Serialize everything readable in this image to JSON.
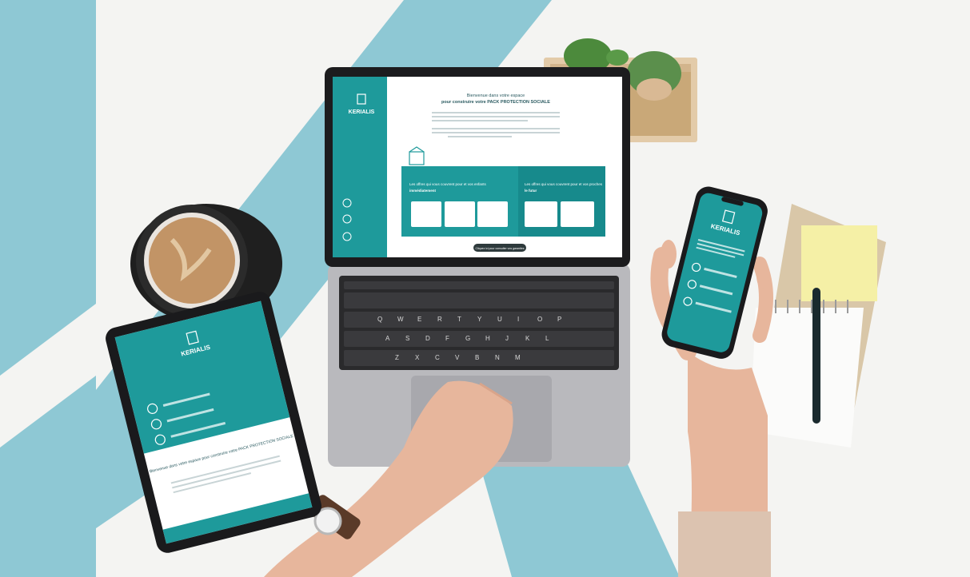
{
  "colors": {
    "teal_stripe": "#8ec8d4",
    "brand_teal": "#1e9a9b",
    "brand_teal_dark": "#157f82",
    "desk": "#f4f4f2",
    "laptop_body": "#b9b9bd",
    "keyboard": "#2a2a2c",
    "coffee": "#c29466",
    "sticky_note": "#f5f0a6",
    "notebook_cover": "#d9c7a8"
  },
  "brand": {
    "logo_text": "KERIALIS"
  },
  "laptop_screen": {
    "heading_line1": "Bienvenue dans votre espace",
    "heading_line2": "pour construire votre PACK PROTECTION SOCIALE",
    "panel_left_title": "Les offres qui vous couvrent pour et vos enfants",
    "panel_left_subtitle": "immédiatement",
    "panel_right_title": "Les offres qui vous couvrent pour et vos proches",
    "panel_right_subtitle": "le futur",
    "cta_button": "Cliquez ici pour consulter vos garanties"
  },
  "keyboard": {
    "row1": [
      "Q",
      "W",
      "E",
      "R",
      "T",
      "Y",
      "U",
      "I",
      "O",
      "P"
    ],
    "row2": [
      "A",
      "S",
      "D",
      "F",
      "G",
      "H",
      "J",
      "K",
      "L"
    ],
    "row3": [
      "Z",
      "X",
      "C",
      "V",
      "B",
      "N",
      "M"
    ]
  },
  "tablet_screen": {
    "logo_text": "KERIALIS",
    "heading": "Bienvenue dans votre espace pour construire votre PACK PROTECTION SOCIALE"
  },
  "phone_screen": {
    "logo_text": "KERIALIS"
  },
  "icons": {
    "logo": "kerialis-logo-icon",
    "box": "package-icon",
    "step": "step-circle-icon"
  }
}
